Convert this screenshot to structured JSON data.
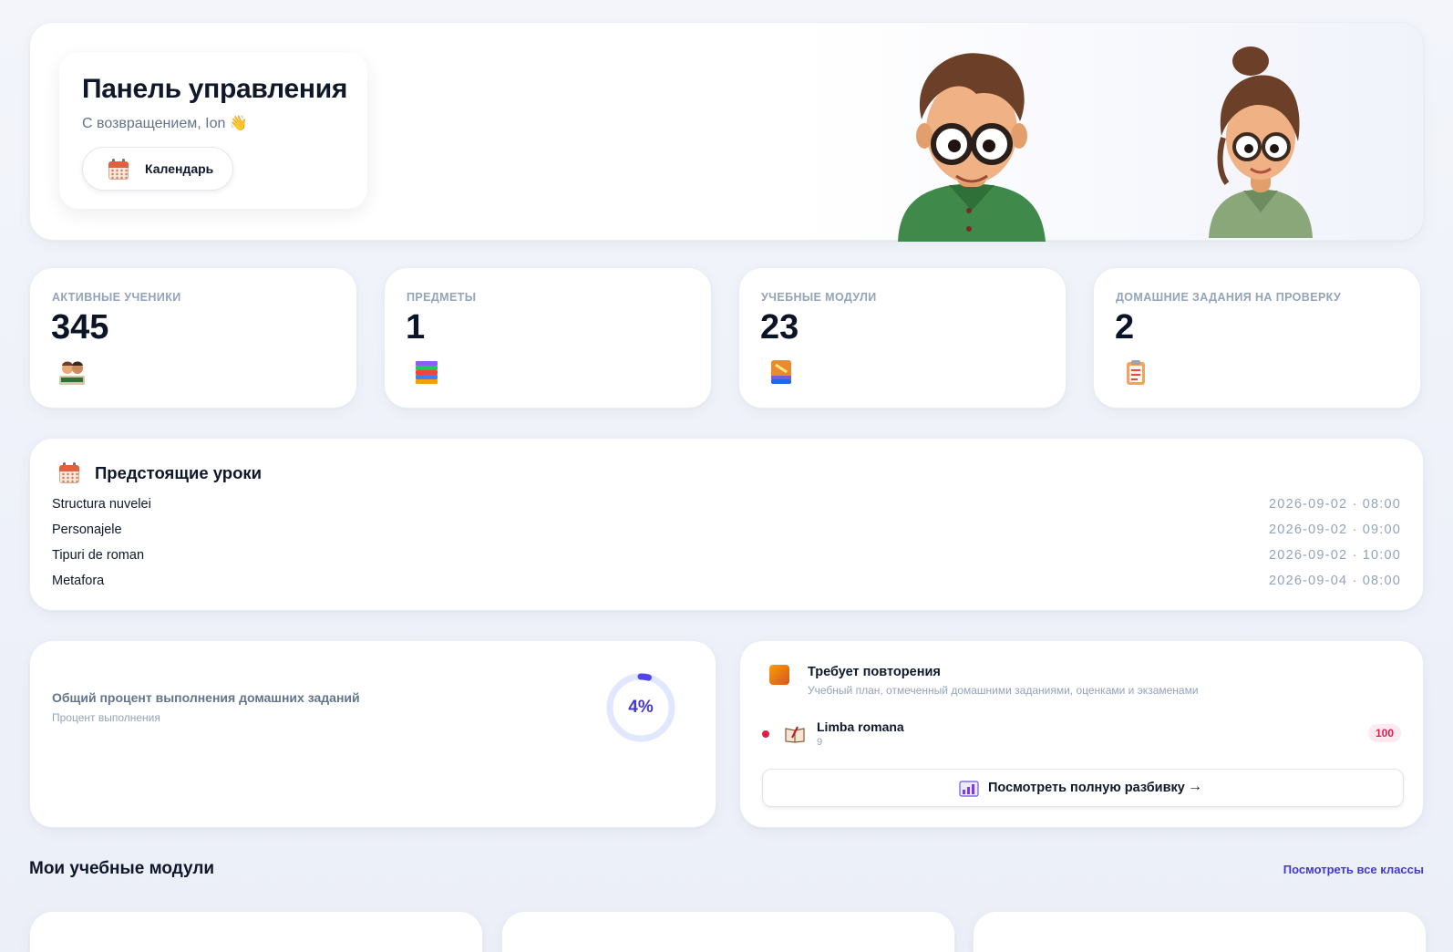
{
  "hero": {
    "title": "Панель управления",
    "subtitle": "С возвращением, Ion 👋",
    "calendar_label": "Календарь"
  },
  "stats": [
    {
      "label": "АКТИВНЫЕ УЧЕНИКИ",
      "value": "345",
      "icon": "students-icon"
    },
    {
      "label": "ПРЕДМЕТЫ",
      "value": "1",
      "icon": "books-icon"
    },
    {
      "label": "УЧЕБНЫЕ МОДУЛИ",
      "value": "23",
      "icon": "module-book-icon"
    },
    {
      "label": "ДОМАШНИЕ ЗАДАНИЯ НА ПРОВЕРКУ",
      "value": "2",
      "icon": "clipboard-icon"
    }
  ],
  "upcoming": {
    "title": "Предстоящие уроки",
    "lessons": [
      {
        "name": "Structura nuvelei",
        "time": "2026-09-02 · 08:00"
      },
      {
        "name": "Personajele",
        "time": "2026-09-02 · 09:00"
      },
      {
        "name": "Tipuri de roman",
        "time": "2026-09-02 · 10:00"
      },
      {
        "name": "Metafora",
        "time": "2026-09-04 · 08:00"
      }
    ]
  },
  "homework": {
    "title": "Общий процент выполнения домашних заданий",
    "subtitle": "Процент выполнения",
    "percent_label": "4%",
    "percent_value": 4
  },
  "review": {
    "title": "Требует повторения",
    "subtitle": "Учебный план, отмеченный домашними заданиями, оценками и экзаменами",
    "item_name": "Limba romana",
    "item_sub": "9",
    "item_badge": "100",
    "button_label": "Посмотреть полную разбивку",
    "button_arrow": "→"
  },
  "modules_section": {
    "title": "Мои учебные модули",
    "link": "Посмотреть все классы"
  },
  "colors": {
    "accent": "#4338ca",
    "danger": "#e11d48",
    "muted": "#94a3b8"
  }
}
